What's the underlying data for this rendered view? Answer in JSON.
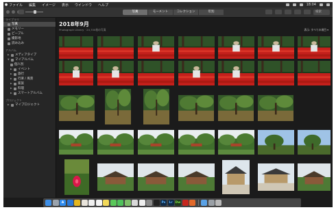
{
  "menubar": {
    "app_name": "ファイル",
    "menus": [
      "編集",
      "イメージ",
      "表示",
      "ウインドウ",
      "ヘルプ"
    ],
    "clock": "18:04"
  },
  "toolbar": {
    "view_tabs": [
      {
        "label": "写真",
        "active": true
      },
      {
        "label": "モーメント",
        "active": false
      },
      {
        "label": "コレクション",
        "active": false
      },
      {
        "label": "年別",
        "active": false
      }
    ],
    "search_placeholder": "検索"
  },
  "sidebar": {
    "library_header": "ライブラリ",
    "library_items": [
      {
        "label": "写真",
        "selected": true,
        "icon": "photos-icon"
      },
      {
        "label": "メモリー",
        "selected": false,
        "icon": "memories-icon"
      },
      {
        "label": "ピープル",
        "selected": false,
        "icon": "people-icon"
      },
      {
        "label": "撮影地",
        "selected": false,
        "icon": "places-icon"
      },
      {
        "label": "読み込み",
        "selected": false,
        "icon": "imports-icon"
      }
    ],
    "albums_header": "アルバム",
    "album_items": [
      {
        "label": "メディアタイプ",
        "sub": false,
        "icon": "folder-icon"
      },
      {
        "label": "マイアルバム",
        "sub": false,
        "icon": "folder-icon"
      },
      {
        "label": "個人別",
        "sub": true,
        "icon": "album-icon"
      },
      {
        "label": "イベント",
        "sub": true,
        "icon": "folder-icon"
      },
      {
        "label": "旅行",
        "sub": true,
        "icon": "folder-icon"
      },
      {
        "label": "行楽 / 風景",
        "sub": true,
        "icon": "folder-icon"
      },
      {
        "label": "家族",
        "sub": true,
        "icon": "folder-icon"
      },
      {
        "label": "料理",
        "sub": true,
        "icon": "folder-icon"
      },
      {
        "label": "スマートアルバム",
        "sub": true,
        "icon": "folder-icon"
      }
    ],
    "projects_header": "プロジェクト",
    "project_items": [
      {
        "label": "マイプロジェクト",
        "icon": "folder-icon"
      }
    ]
  },
  "main": {
    "title": "2018年9月",
    "subtitle": "Photograph Library · 24,700枚の写真",
    "show_all": "表示: すべての項目 ▾"
  },
  "photos": [
    {
      "scene": "red-flowers"
    },
    {
      "scene": "red-flowers"
    },
    {
      "scene": "red-flowers-person"
    },
    {
      "scene": "red-flowers"
    },
    {
      "scene": "red-flowers-person"
    },
    {
      "scene": "red-flowers-person"
    },
    {
      "scene": "red-flowers-person"
    },
    {
      "scene": "red-flowers-person"
    },
    {
      "scene": "red-flowers-person"
    },
    {
      "scene": "red-flowers"
    },
    {
      "scene": "red-flowers-person"
    },
    {
      "scene": "red-flowers-person"
    },
    {
      "scene": "red-flowers"
    },
    {
      "scene": "red-flowers"
    },
    {
      "scene": "forest"
    },
    {
      "scene": "forest"
    },
    {
      "scene": "forest"
    },
    {
      "scene": "forest"
    },
    {
      "scene": "forest"
    },
    {
      "scene": "forest"
    },
    {
      "scene": "garden"
    },
    {
      "scene": "garden"
    },
    {
      "scene": "garden"
    },
    {
      "scene": "garden"
    },
    {
      "scene": "garden"
    },
    {
      "scene": "trees-sky"
    },
    {
      "scene": "trees-sky"
    },
    {
      "scene": "red-flower-closeup"
    },
    {
      "scene": "building"
    },
    {
      "scene": "building"
    },
    {
      "scene": "building"
    },
    {
      "scene": "temple"
    },
    {
      "scene": "temple"
    },
    {
      "scene": "building"
    }
  ],
  "dock": [
    {
      "name": "finder-icon",
      "color": "#3d8ee6",
      "glyph": ""
    },
    {
      "name": "launchpad-icon",
      "color": "#9aa3ad",
      "glyph": ""
    },
    {
      "name": "app-store-icon",
      "color": "#2f8cf0",
      "glyph": "A"
    },
    {
      "name": "safari-icon",
      "color": "#2b78d8",
      "glyph": ""
    },
    {
      "name": "chrome-icon",
      "color": "#e5b71f",
      "glyph": ""
    },
    {
      "name": "photos-app-icon",
      "color": "#e9e4db",
      "glyph": ""
    },
    {
      "name": "mail-icon",
      "color": "#f0f0f0",
      "glyph": ""
    },
    {
      "name": "calendar-icon",
      "color": "#f4f4f4",
      "glyph": ""
    },
    {
      "name": "notes-icon",
      "color": "#f2d95a",
      "glyph": ""
    },
    {
      "name": "messages-icon",
      "color": "#5ac85a",
      "glyph": ""
    },
    {
      "name": "facetime-icon",
      "color": "#4fc25b",
      "glyph": ""
    },
    {
      "name": "maps-icon",
      "color": "#7fbf6a",
      "glyph": ""
    },
    {
      "name": "preview-icon",
      "color": "#d9d9d9",
      "glyph": ""
    },
    {
      "name": "textedit-icon",
      "color": "#eeeeee",
      "glyph": ""
    },
    {
      "name": "system-prefs-icon",
      "color": "#8a8a8a",
      "glyph": ""
    },
    {
      "name": "terminal-icon",
      "color": "#222222",
      "glyph": ""
    },
    {
      "name": "photoshop-icon",
      "color": "#0f2a47",
      "glyph": "Ps"
    },
    {
      "name": "lightroom-icon",
      "color": "#0f2a47",
      "glyph": "Lr"
    },
    {
      "name": "dreamweaver-icon",
      "color": "#1f3a1a",
      "glyph": "Dw"
    },
    {
      "name": "acrobat-icon",
      "color": "#c7271e",
      "glyph": ""
    },
    {
      "name": "firefox-icon",
      "color": "#e2692a",
      "glyph": ""
    },
    {
      "name": "folder-dock-icon",
      "color": "#5aa2e6",
      "glyph": ""
    },
    {
      "name": "image-capture-icon",
      "color": "#9aa0a6",
      "glyph": ""
    },
    {
      "name": "trash-icon",
      "color": "#b8b8b8",
      "glyph": ""
    }
  ]
}
